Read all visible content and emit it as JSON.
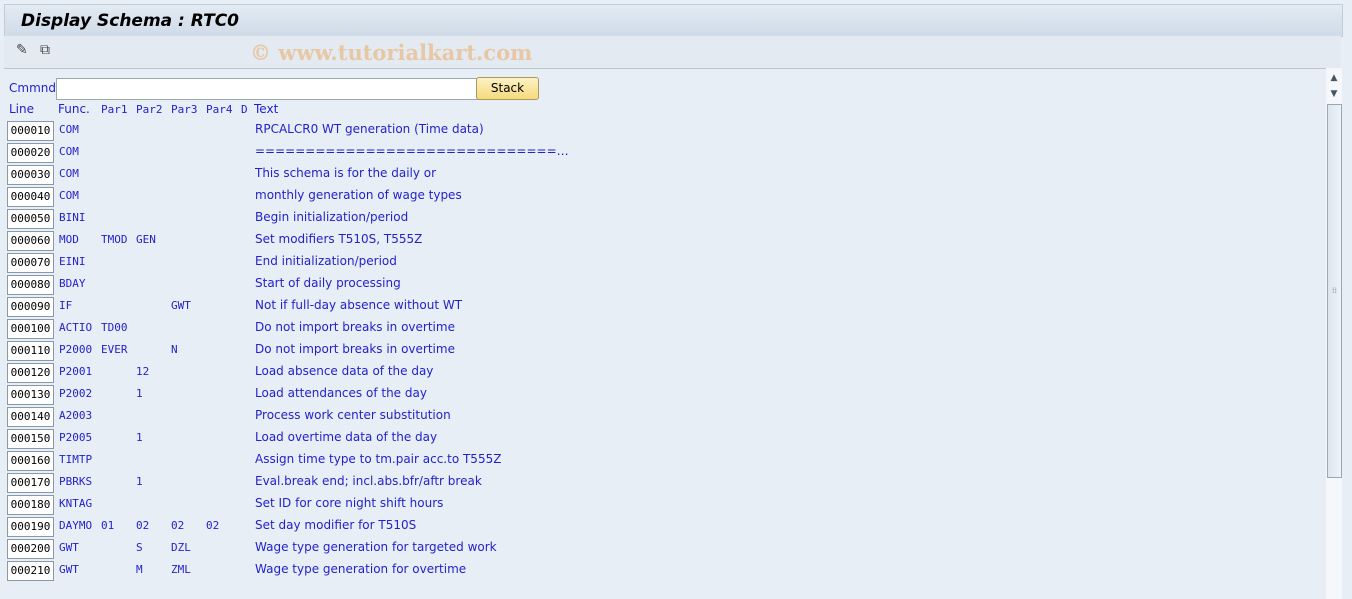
{
  "window": {
    "title": "Display Schema : RTC0"
  },
  "toolbar": {
    "icons": [
      "edit-icon",
      "hierarchy-icon"
    ],
    "watermark": "© www.tutorialkart.com"
  },
  "command": {
    "label": "Cmmnd",
    "value": "",
    "stack_label": "Stack"
  },
  "headers": {
    "line": "Line",
    "func": "Func.",
    "par1": "Par1",
    "par2": "Par2",
    "par3": "Par3",
    "par4": "Par4",
    "d": "D",
    "text": "Text"
  },
  "rows": [
    {
      "line": "000010",
      "func": "COM",
      "par1": "",
      "par2": "",
      "par3": "",
      "par4": "",
      "text": "RPCALCR0 WT generation (Time data)"
    },
    {
      "line": "000020",
      "func": "COM",
      "par1": "",
      "par2": "",
      "par3": "",
      "par4": "",
      "text": "==============================…"
    },
    {
      "line": "000030",
      "func": "COM",
      "par1": "",
      "par2": "",
      "par3": "",
      "par4": "",
      "text": "This schema is for the daily or"
    },
    {
      "line": "000040",
      "func": "COM",
      "par1": "",
      "par2": "",
      "par3": "",
      "par4": "",
      "text": "monthly generation of wage types"
    },
    {
      "line": "000050",
      "func": "BINI",
      "par1": "",
      "par2": "",
      "par3": "",
      "par4": "",
      "text": "Begin initialization/period"
    },
    {
      "line": "000060",
      "func": "MOD",
      "par1": "TMOD",
      "par2": "GEN",
      "par3": "",
      "par4": "",
      "text": "Set modifiers T510S, T555Z"
    },
    {
      "line": "000070",
      "func": "EINI",
      "par1": "",
      "par2": "",
      "par3": "",
      "par4": "",
      "text": "End initialization/period"
    },
    {
      "line": "000080",
      "func": "BDAY",
      "par1": "",
      "par2": "",
      "par3": "",
      "par4": "",
      "text": "Start of daily processing"
    },
    {
      "line": "000090",
      "func": "IF",
      "par1": "",
      "par2": "",
      "par3": "GWT",
      "par4": "",
      "text": "Not if full-day absence without WT"
    },
    {
      "line": "000100",
      "func": "ACTIO",
      "par1": "TD00",
      "par2": "",
      "par3": "",
      "par4": "",
      "text": "Do not import breaks in overtime"
    },
    {
      "line": "000110",
      "func": "P2000",
      "par1": "EVER",
      "par2": "",
      "par3": "N",
      "par4": "",
      "text": "Do not import breaks in overtime"
    },
    {
      "line": "000120",
      "func": "P2001",
      "par1": "",
      "par2": "12",
      "par3": "",
      "par4": "",
      "text": "Load absence data of the day"
    },
    {
      "line": "000130",
      "func": "P2002",
      "par1": "",
      "par2": "1",
      "par3": "",
      "par4": "",
      "text": "Load attendances of the day"
    },
    {
      "line": "000140",
      "func": "A2003",
      "par1": "",
      "par2": "",
      "par3": "",
      "par4": "",
      "text": "Process work center substitution"
    },
    {
      "line": "000150",
      "func": "P2005",
      "par1": "",
      "par2": "1",
      "par3": "",
      "par4": "",
      "text": "Load overtime data of the day"
    },
    {
      "line": "000160",
      "func": "TIMTP",
      "par1": "",
      "par2": "",
      "par3": "",
      "par4": "",
      "text": "Assign time type to tm.pair acc.to T555Z"
    },
    {
      "line": "000170",
      "func": "PBRKS",
      "par1": "",
      "par2": "1",
      "par3": "",
      "par4": "",
      "text": "Eval.break end; incl.abs.bfr/aftr break"
    },
    {
      "line": "000180",
      "func": "KNTAG",
      "par1": "",
      "par2": "",
      "par3": "",
      "par4": "",
      "text": "Set ID for core night shift hours"
    },
    {
      "line": "000190",
      "func": "DAYMO",
      "par1": "01",
      "par2": "02",
      "par3": "02",
      "par4": "02",
      "text": "Set day modifier for T510S"
    },
    {
      "line": "000200",
      "func": "GWT",
      "par1": "",
      "par2": "S",
      "par3": "DZL",
      "par4": "",
      "text": "Wage type generation for targeted work"
    },
    {
      "line": "000210",
      "func": "GWT",
      "par1": "",
      "par2": "M",
      "par3": "ZML",
      "par4": "",
      "text": "Wage type generation for overtime"
    }
  ]
}
